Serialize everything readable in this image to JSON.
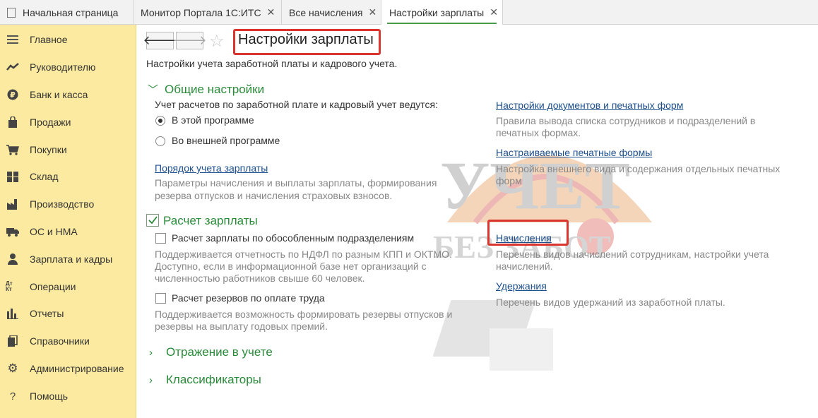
{
  "tabs": [
    {
      "label": "Начальная страница",
      "closable": false,
      "active": false
    },
    {
      "label": "Монитор Портала 1С:ИТС",
      "closable": true,
      "active": false
    },
    {
      "label": "Все начисления",
      "closable": true,
      "active": false
    },
    {
      "label": "Настройки зарплаты",
      "closable": true,
      "active": true
    }
  ],
  "sidebar": {
    "items": [
      {
        "label": "Главное",
        "icon": "menu-icon"
      },
      {
        "label": "Руководителю",
        "icon": "trend-icon"
      },
      {
        "label": "Банк и касса",
        "icon": "ruble-icon"
      },
      {
        "label": "Продажи",
        "icon": "bag-icon"
      },
      {
        "label": "Покупки",
        "icon": "cart-icon"
      },
      {
        "label": "Склад",
        "icon": "warehouse-icon"
      },
      {
        "label": "Производство",
        "icon": "factory-icon"
      },
      {
        "label": "ОС и НМА",
        "icon": "truck-icon"
      },
      {
        "label": "Зарплата и кадры",
        "icon": "person-icon"
      },
      {
        "label": "Операции",
        "icon": "dt-kt-icon"
      },
      {
        "label": "Отчеты",
        "icon": "bar-chart-icon"
      },
      {
        "label": "Справочники",
        "icon": "books-icon"
      },
      {
        "label": "Администрирование",
        "icon": "gear-icon"
      },
      {
        "label": "Помощь",
        "icon": "question-icon"
      }
    ],
    "dt_kt_label": "Дт Кт"
  },
  "header": {
    "title": "Настройки зарплаты",
    "description": "Настройки учета заработной платы и кадрового учета."
  },
  "general": {
    "title": "Общие настройки",
    "accounting_label": "Учет расчетов по заработной плате и кадровый учет ведутся:",
    "radio_this": "В этой программе",
    "radio_external": "Во внешней программе",
    "selected": "В этой программе",
    "order_link": "Порядок учета зарплаты",
    "order_desc_1": "Параметры начисления и выплаты зарплаты, формирования",
    "order_desc_2": "резерва отпусков и начисления страховых взносов.",
    "docs_link": "Настройки документов и печатных форм",
    "docs_desc_1": "Правила вывода списка сотрудников и подразделений в",
    "docs_desc_2": "печатных формах.",
    "print_link": "Настраиваемые печатные формы",
    "print_desc_1": "Настройка внешнего вида и содержания отдельных печатных",
    "print_desc_2": "форм"
  },
  "payroll": {
    "title": "Расчет зарплаты",
    "separate_label": "Расчет зарплаты по обособленным подразделениям",
    "separate_desc_1": "Поддерживается отчетность по НДФЛ по разным КПП и ОКТМО.",
    "separate_desc_2": "Доступно, если в информационной базе нет организаций с",
    "separate_desc_3": "численностью работников свыше 60 человек.",
    "reserves_label": "Расчет резервов по оплате труда",
    "reserves_desc_1": "Поддерживается возможность формировать резервы отпусков и",
    "reserves_desc_2": "резервы на выплату годовых премий.",
    "accruals_link": "Начисления",
    "accruals_desc_1": "Перечень видов начислений сотрудникам, настройки учета",
    "accruals_desc_2": "начислений.",
    "deductions_link": "Удержания",
    "deductions_desc": "Перечень видов удержаний из заработной платы."
  },
  "sections_collapsed": [
    "Отражение в учете",
    "Классификаторы"
  ],
  "watermark": {
    "line1": "УЧЕТ",
    "line2": "БЕЗ ЗАБОТ"
  },
  "colors": {
    "sidebar_bg": "#fbeaa0",
    "section_green": "#2a8a3a",
    "link_blue": "#1c4f8c",
    "highlight_red": "#d9352e"
  }
}
